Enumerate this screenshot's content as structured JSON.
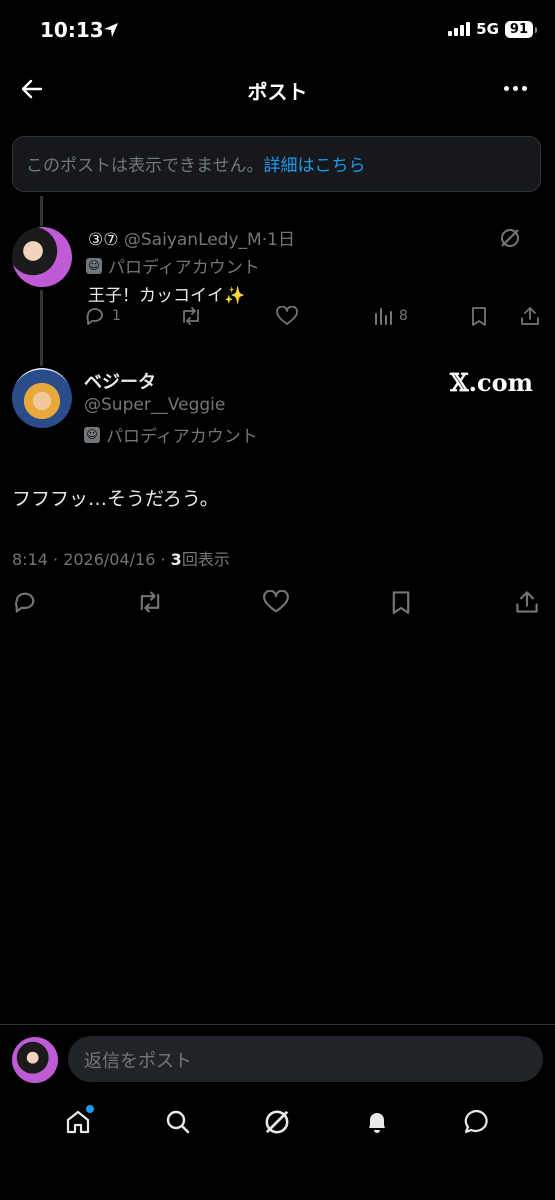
{
  "status_bar": {
    "time": "10:13",
    "network": "5G",
    "battery": "91"
  },
  "header": {
    "title": "ポスト"
  },
  "notice": {
    "text": "このポストは表示できません。",
    "link": "詳細はこちら"
  },
  "reply": {
    "display_name": "③⑦",
    "handle": "@SaiyanLedy_M",
    "time": "·1日",
    "label": "パロディアカウント",
    "text": "王子！カッコイイ",
    "emoji": "✨",
    "reply_count": "1",
    "view_count": "8"
  },
  "main_post": {
    "display_name": "ベジータ",
    "handle": "@Super__Veggie",
    "label": "パロディアカウント",
    "watermark": "𝕏.com",
    "text": "フフフッ…そうだろう。",
    "timestamp": "8:14 · 2026/04/16 · ",
    "views_number": "3",
    "views_label": "回表示"
  },
  "composer": {
    "placeholder": "返信をポスト"
  },
  "icons": {
    "back": "arrow-left-icon",
    "more": "more-icon",
    "grok": "grok-icon",
    "reply": "reply-icon",
    "repost": "repost-icon",
    "like": "heart-icon",
    "views": "views-icon",
    "bookmark": "bookmark-icon",
    "share": "share-icon",
    "home": "home-icon",
    "search": "search-icon",
    "notifications": "bell-icon",
    "messages": "message-icon"
  },
  "colors": {
    "accent": "#1d9bf0",
    "background": "#000000",
    "muted": "#71767b",
    "text": "#e7e9ea"
  }
}
